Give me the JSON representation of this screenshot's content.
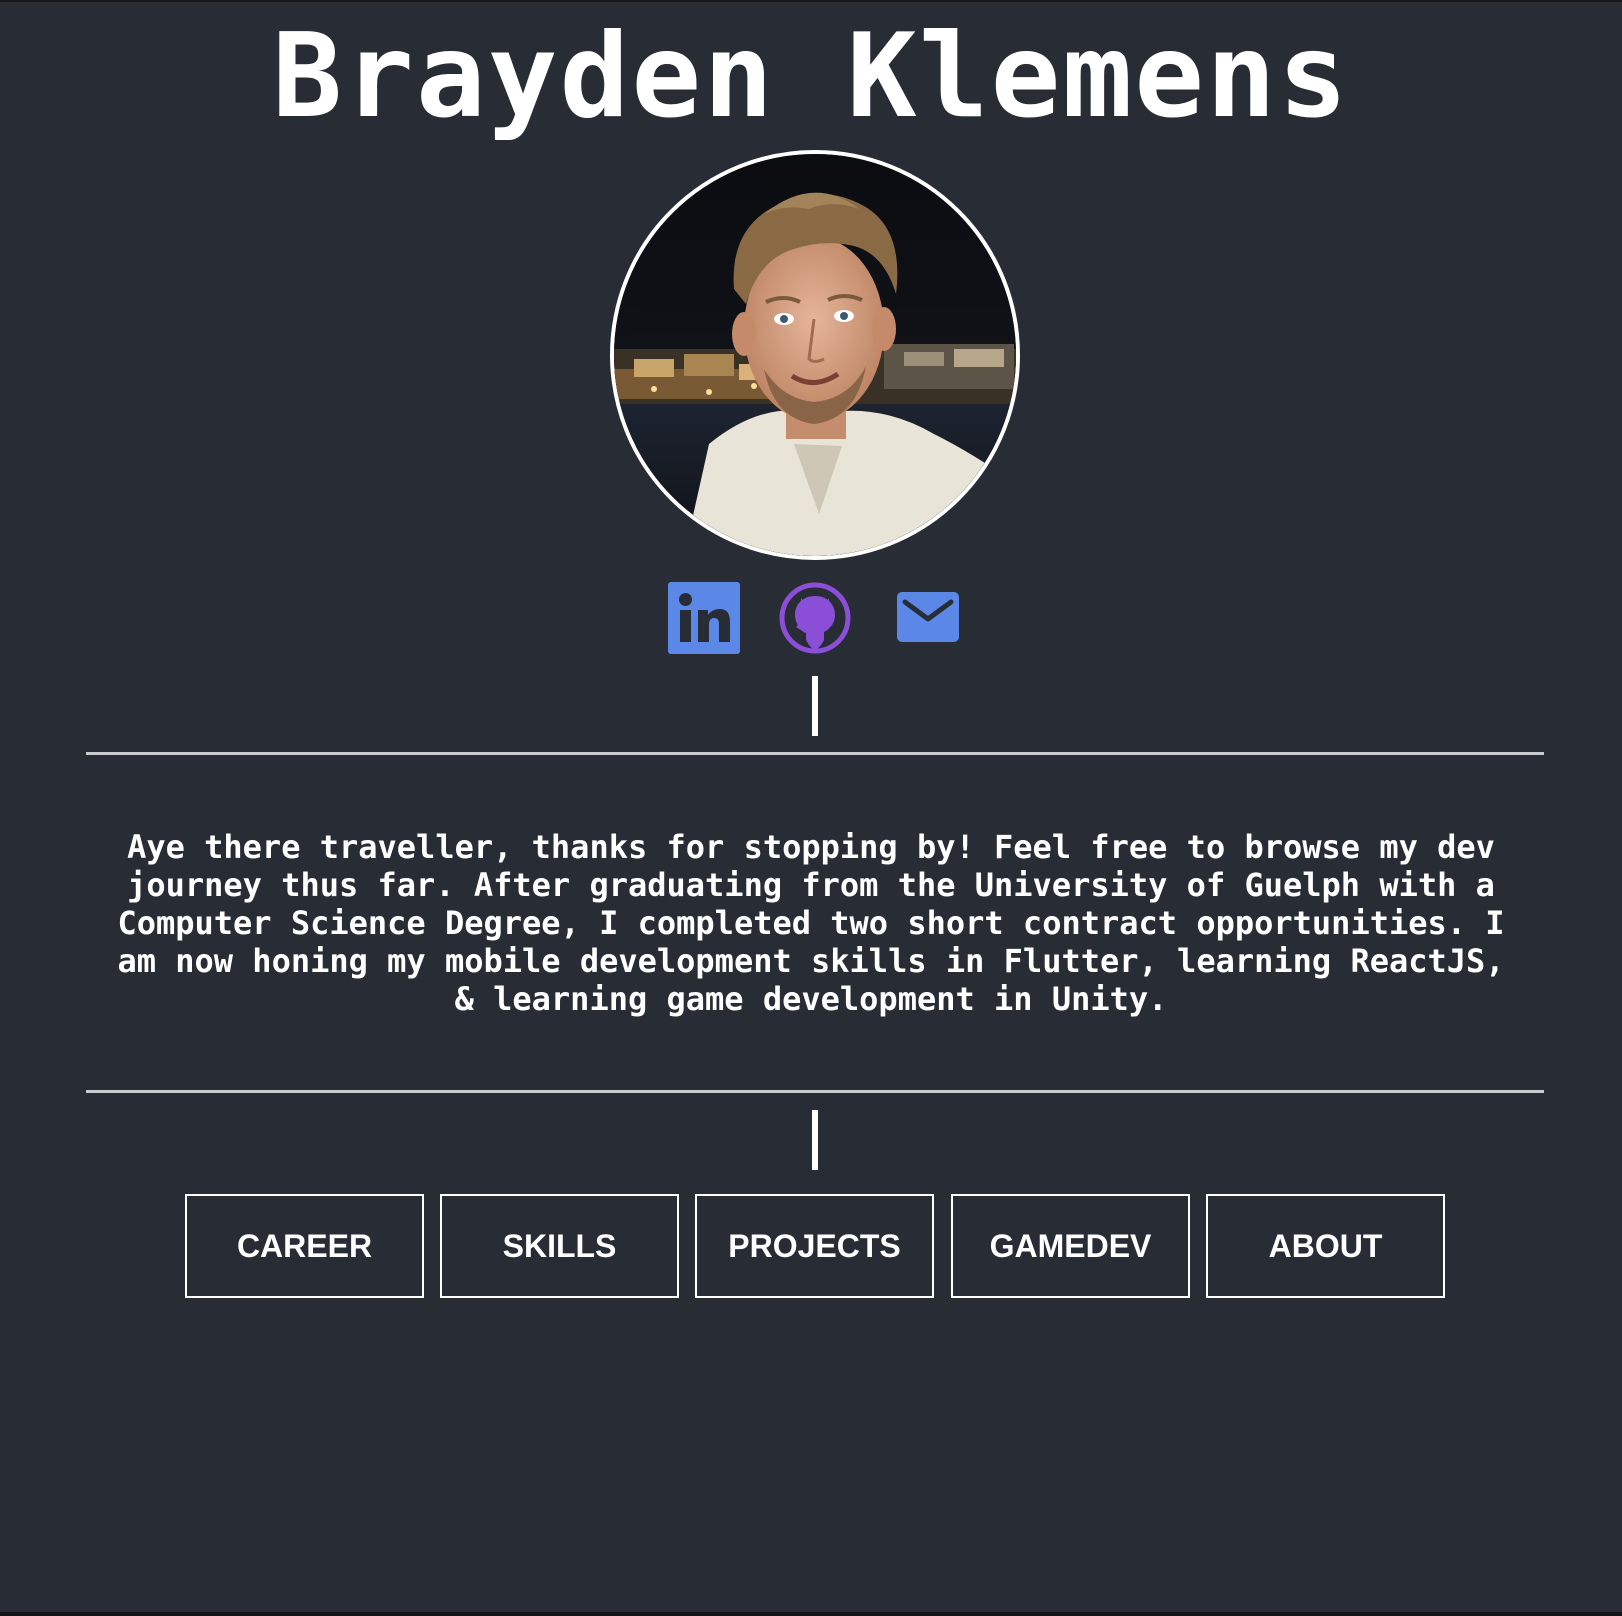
{
  "header": {
    "name": "Brayden Klemens"
  },
  "profile": {
    "avatar": "profile-photo"
  },
  "social": {
    "items": [
      {
        "icon": "linkedin-icon",
        "color": "#5b88e6"
      },
      {
        "icon": "github-icon",
        "color": "#8a4fd6"
      },
      {
        "icon": "email-icon",
        "color": "#5b88e6"
      }
    ]
  },
  "bio": {
    "text": "Aye there traveller, thanks for stopping by! Feel free to browse my dev journey thus far. After graduating from the University of Guelph with a Computer Science Degree, I completed two short contract opportunities. I am now honing my mobile development skills in Flutter, learning ReactJS, & learning game development in Unity."
  },
  "nav": {
    "career": "CAREER",
    "skills": "SKILLS",
    "projects": "PROJECTS",
    "gamedev": "GAMEDEV",
    "about": "ABOUT"
  },
  "colors": {
    "background": "#282c34",
    "text": "#ffffff",
    "rule": "#c9cbcf"
  }
}
